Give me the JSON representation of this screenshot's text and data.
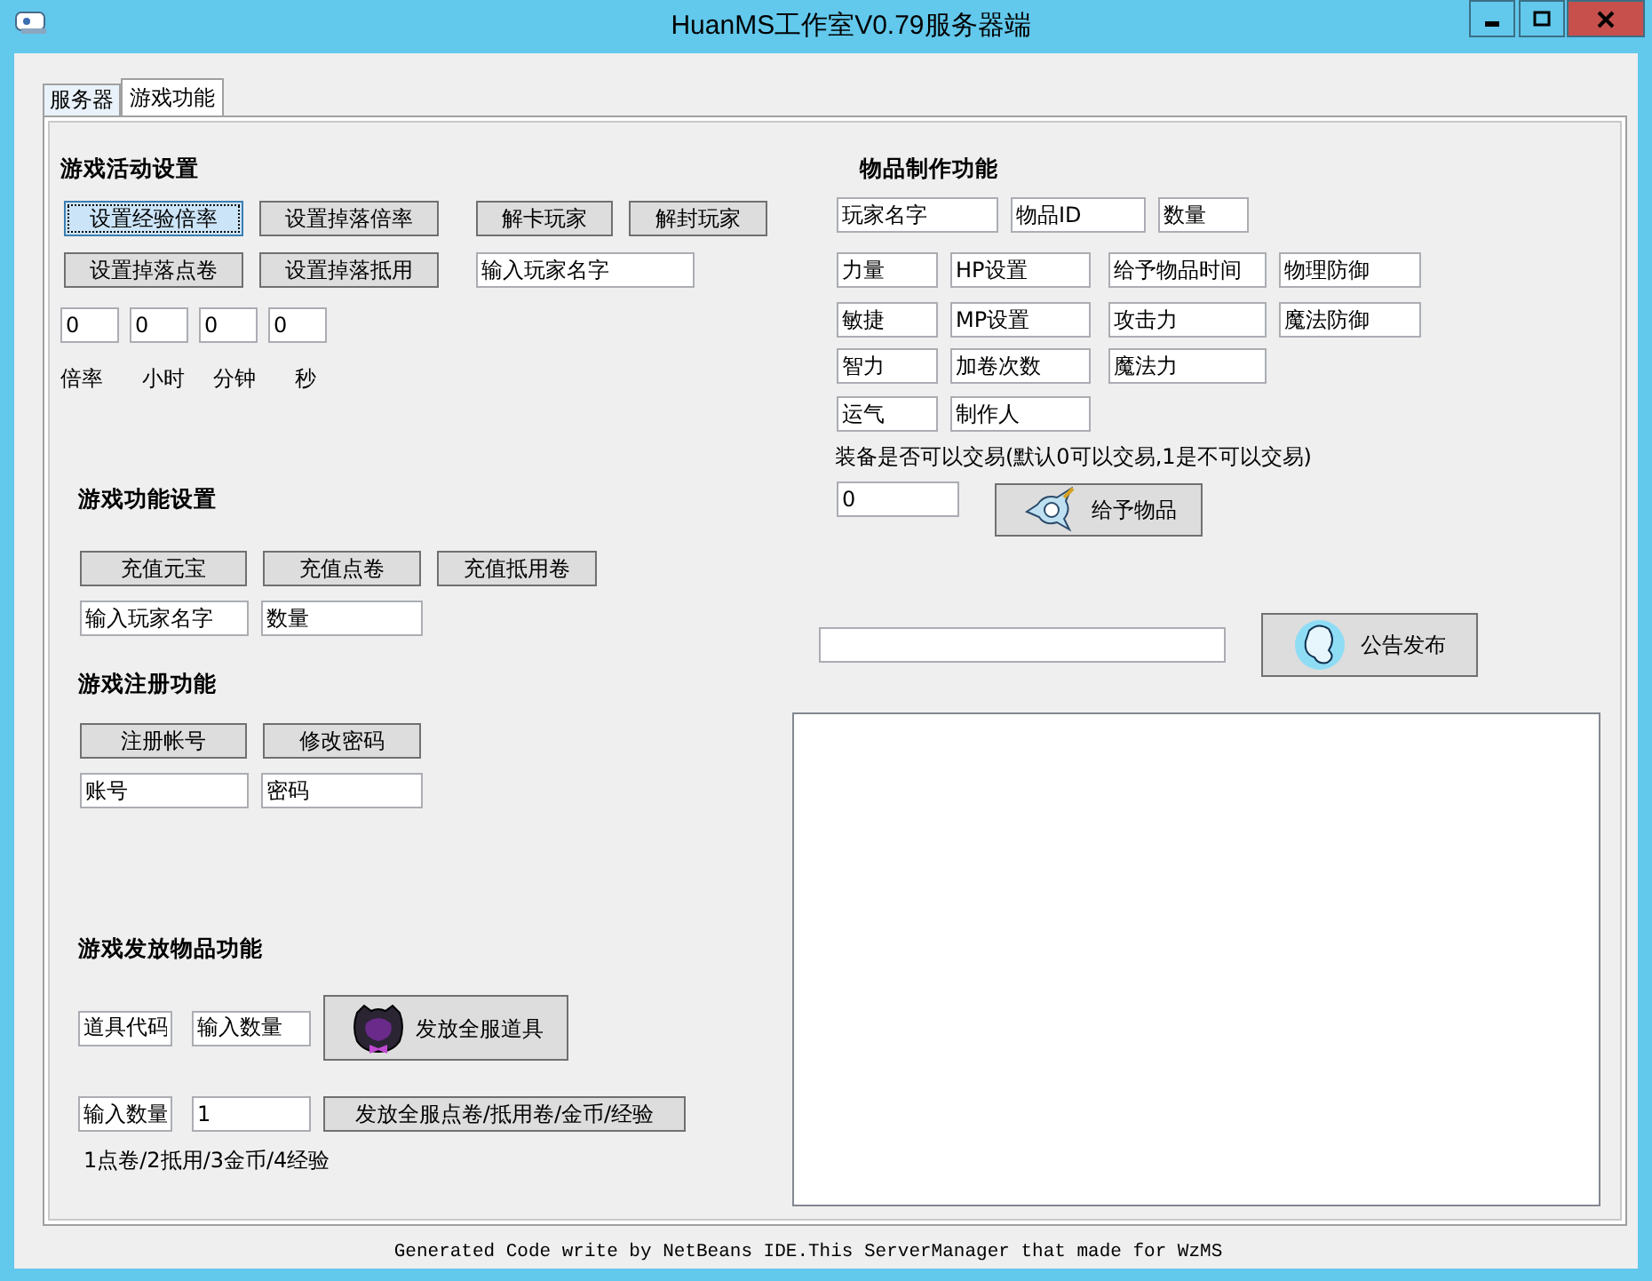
{
  "window": {
    "title": "HuanMS工作室V0.79服务器端"
  },
  "tabs": [
    {
      "label": "服务器",
      "selected": false
    },
    {
      "label": "游戏功能",
      "selected": true
    }
  ],
  "activity": {
    "title": "游戏活动设置",
    "row_1": [
      {
        "label": "设置经验倍率",
        "focused": true
      },
      {
        "label": "设置掉落倍率",
        "focused": false
      },
      {
        "label": "解卡玩家",
        "focused": false
      },
      {
        "label": "解封玩家",
        "focused": false
      }
    ],
    "row_2": [
      {
        "label": "设置掉落点卷",
        "focused": false
      },
      {
        "label": "设置掉落抵用",
        "focused": false
      }
    ],
    "player_field": "输入玩家名字",
    "time_fields": [
      "0",
      "0",
      "0",
      "0"
    ],
    "time_labels": [
      "倍率",
      "小时",
      "分钟",
      "秒"
    ]
  },
  "recharge": {
    "title": "游戏功能设置",
    "buttons": [
      {
        "label": "充值元宝",
        "focused": false
      },
      {
        "label": "充值点卷",
        "focused": false
      },
      {
        "label": "充值抵用卷",
        "focused": false
      }
    ],
    "fields": [
      "输入玩家名字",
      "数量"
    ]
  },
  "register": {
    "title": "游戏注册功能",
    "buttons": [
      {
        "label": "注册帐号",
        "focused": false
      },
      {
        "label": "修改密码",
        "focused": false
      }
    ],
    "fields": [
      "账号",
      "密码"
    ]
  },
  "giveaway": {
    "title": "游戏发放物品功能",
    "item_fields": [
      "道具代码",
      "输入数量"
    ],
    "item_button": "发放全服道具",
    "amount_fields": [
      "输入数量",
      "1"
    ],
    "amount_button": "发放全服点卷/抵用卷/金币/经验",
    "hint": "1点卷/2抵用/3金币/4经验"
  },
  "item_making": {
    "title": "物品制作功能",
    "top_fields": [
      "玩家名字",
      "物品ID",
      "数量"
    ],
    "grid": [
      [
        "力量",
        "HP设置",
        "给予物品时间",
        "物理防御"
      ],
      [
        "敏捷",
        "MP设置",
        "攻击力",
        "魔法防御"
      ],
      [
        "智力",
        "加卷次数",
        "魔法力"
      ],
      [
        "运气",
        "制作人"
      ]
    ],
    "trade_hint": "装备是否可以交易(默认0可以交易,1是不可以交易)",
    "trade_field": "0",
    "give_button": "给予物品"
  },
  "notice": {
    "button": "公告发布"
  },
  "status_bar": "Generated Code write by NetBeans IDE.This ServerManager that made for WzMS"
}
